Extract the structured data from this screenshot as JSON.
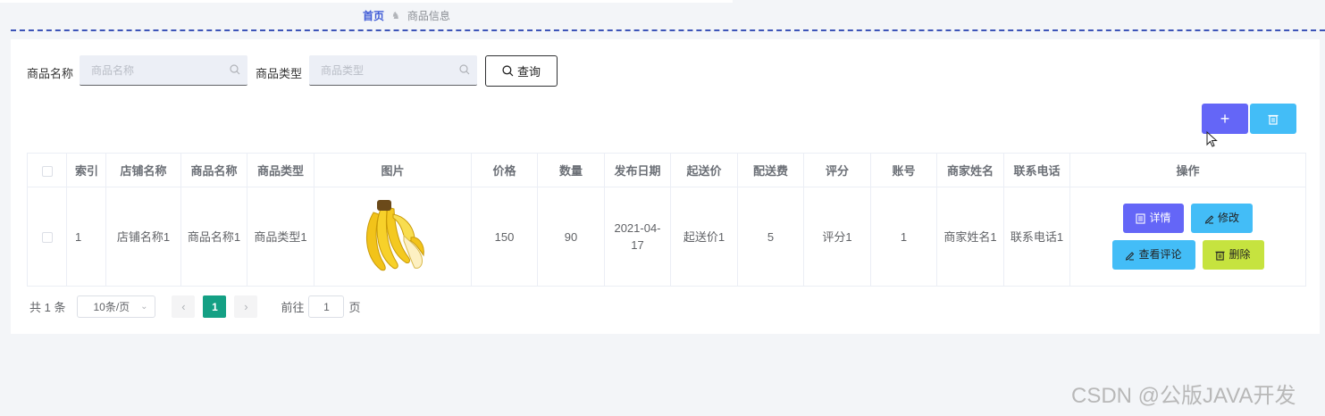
{
  "breadcrumb": {
    "home": "首页",
    "separator": "♞",
    "current": "商品信息"
  },
  "search": {
    "name_label": "商品名称",
    "name_placeholder": "商品名称",
    "type_label": "商品类型",
    "type_placeholder": "商品类型",
    "query_label": "查询"
  },
  "toolbar": {
    "add_icon": "plus-icon",
    "delete_icon": "trash-icon"
  },
  "table": {
    "headers": [
      "",
      "索引",
      "店铺名称",
      "商品名称",
      "商品类型",
      "图片",
      "价格",
      "数量",
      "发布日期",
      "起送价",
      "配送费",
      "评分",
      "账号",
      "商家姓名",
      "联系电话",
      "操作"
    ],
    "rows": [
      {
        "index": "1",
        "shop": "店铺名称1",
        "name": "商品名称1",
        "type": "商品类型1",
        "image": "banana-image",
        "price": "150",
        "qty": "90",
        "date": "2021-04-17",
        "min_price": "起送价1",
        "fee": "5",
        "rating": "评分1",
        "account": "1",
        "merchant": "商家姓名1",
        "phone": "联系电话1"
      }
    ],
    "ops": {
      "detail": "详情",
      "edit": "修改",
      "review": "查看评论",
      "delete": "删除"
    }
  },
  "pager": {
    "total": "共 1 条",
    "size": "10条/页",
    "page": "1",
    "goto": "前往",
    "jump_value": "1",
    "unit": "页"
  },
  "watermark": "CSDN @公版JAVA开发",
  "colors": {
    "primary": "#6466f7",
    "info": "#43bdf7",
    "danger": "#c6e33f",
    "active_page": "#14a084"
  }
}
